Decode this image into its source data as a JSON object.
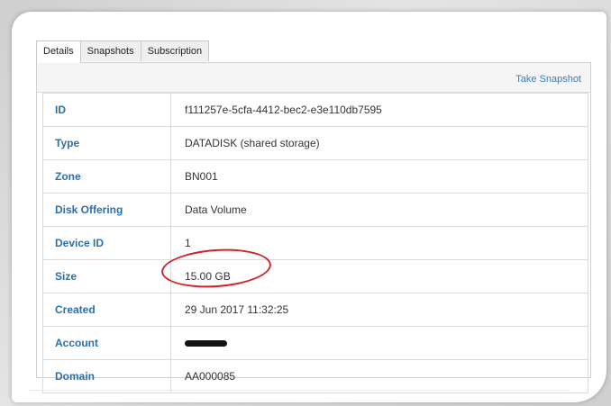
{
  "tabs": [
    {
      "label": "Details",
      "active": true
    },
    {
      "label": "Snapshots",
      "active": false
    },
    {
      "label": "Subscription",
      "active": false
    }
  ],
  "toolbar": {
    "take_snapshot_label": "Take Snapshot"
  },
  "details": [
    {
      "key": "ID",
      "value": "f111257e-5cfa-4412-bec2-e3e110db7595"
    },
    {
      "key": "Type",
      "value": "DATADISK (shared storage)"
    },
    {
      "key": "Zone",
      "value": "BN001"
    },
    {
      "key": "Disk Offering",
      "value": "Data Volume"
    },
    {
      "key": "Device ID",
      "value": "1"
    },
    {
      "key": "Size",
      "value": "15.00 GB"
    },
    {
      "key": "Created",
      "value": "29 Jun 2017 11:32:25"
    },
    {
      "key": "Account",
      "value": ""
    },
    {
      "key": "Domain",
      "value": "AA000085"
    }
  ],
  "annotation": {
    "circle_color": "#d2232a",
    "highlighted_field": "Size"
  },
  "colors": {
    "key_text": "#2d6fa8",
    "link": "#3a7db8"
  }
}
